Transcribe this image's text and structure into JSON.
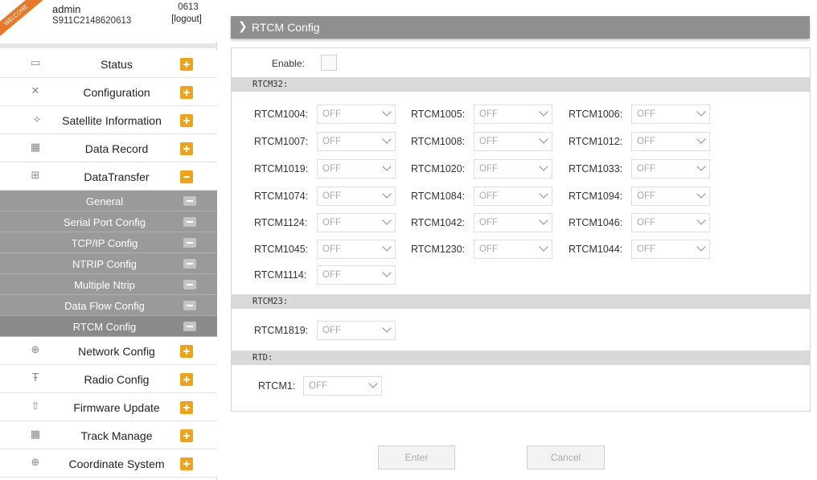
{
  "user": {
    "welcome": "WELCOME",
    "name": "admin",
    "serial": "S911C2148620613",
    "code": "0613",
    "logout": "[logout]"
  },
  "nav": {
    "status": "Status",
    "configuration": "Configuration",
    "satellite": "Satellite Information",
    "data_record": "Data Record",
    "data_transfer": "DataTransfer",
    "sub": {
      "general": "General",
      "serial_port": "Serial Port Config",
      "tcpip": "TCP/IP Config",
      "ntrip": "NTRIP Config",
      "multiple_ntrip": "Multiple Ntrip",
      "data_flow": "Data Flow Config",
      "rtcm": "RTCM Config"
    },
    "network": "Network Config",
    "radio": "Radio Config",
    "firmware": "Firmware Update",
    "track": "Track Manage",
    "coordinate": "Coordinate System"
  },
  "page": {
    "title": "RTCM Config",
    "enable_label": "Enable:",
    "section_rtcm32": "RTCM32:",
    "section_rtcm23": "RTCM23:",
    "section_rtd": "RTD:"
  },
  "rtcm32": {
    "r1004": {
      "label": "RTCM1004:",
      "value": "OFF"
    },
    "r1005": {
      "label": "RTCM1005:",
      "value": "OFF"
    },
    "r1006": {
      "label": "RTCM1006:",
      "value": "OFF"
    },
    "r1007": {
      "label": "RTCM1007:",
      "value": "OFF"
    },
    "r1008": {
      "label": "RTCM1008:",
      "value": "OFF"
    },
    "r1012": {
      "label": "RTCM1012:",
      "value": "OFF"
    },
    "r1019": {
      "label": "RTCM1019:",
      "value": "OFF"
    },
    "r1020": {
      "label": "RTCM1020:",
      "value": "OFF"
    },
    "r1033": {
      "label": "RTCM1033:",
      "value": "OFF"
    },
    "r1074": {
      "label": "RTCM1074:",
      "value": "OFF"
    },
    "r1084": {
      "label": "RTCM1084:",
      "value": "OFF"
    },
    "r1094": {
      "label": "RTCM1094:",
      "value": "OFF"
    },
    "r1124": {
      "label": "RTCM1124:",
      "value": "OFF"
    },
    "r1042": {
      "label": "RTCM1042:",
      "value": "OFF"
    },
    "r1046": {
      "label": "RTCM1046:",
      "value": "OFF"
    },
    "r1045": {
      "label": "RTCM1045:",
      "value": "OFF"
    },
    "r1230": {
      "label": "RTCM1230:",
      "value": "OFF"
    },
    "r1044": {
      "label": "RTCM1044:",
      "value": "OFF"
    },
    "r1114": {
      "label": "RTCM1114:",
      "value": "OFF"
    }
  },
  "rtcm23": {
    "r1819": {
      "label": "RTCM1819:",
      "value": "OFF"
    }
  },
  "rtd": {
    "r1": {
      "label": "RTCM1:",
      "value": "OFF"
    }
  },
  "buttons": {
    "enter": "Enter",
    "cancel": "Cancel"
  },
  "colors": {
    "accent_toggle": "#f0a21b",
    "header_bar": "#8f8f8f",
    "submenu_bg": "#9a9a9a"
  }
}
